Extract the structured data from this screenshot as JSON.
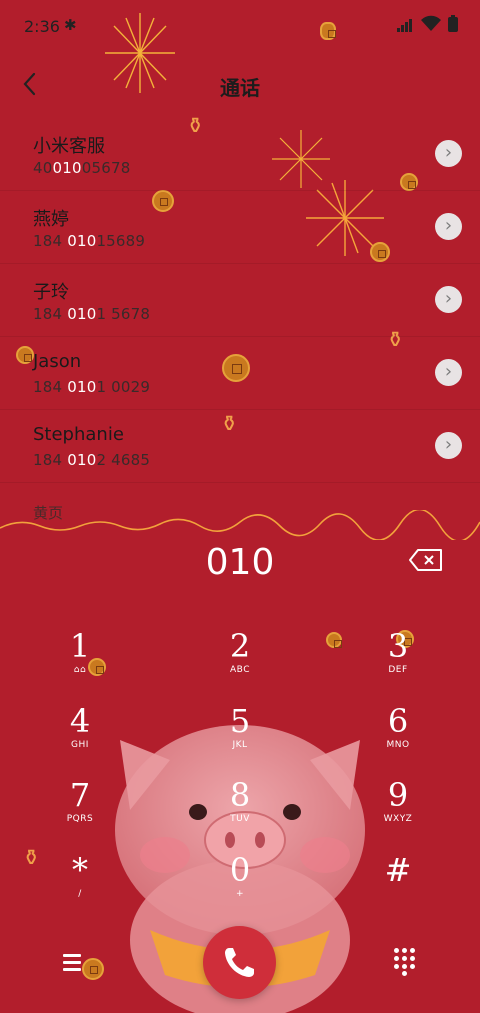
{
  "status_bar": {
    "time": "2:36",
    "bluetooth_icon": "bluetooth-icon",
    "signal_icon": "signal-icon",
    "wifi_icon": "wifi-icon",
    "battery_icon": "battery-icon"
  },
  "header": {
    "title": "通话",
    "back_icon": "chevron-left-icon"
  },
  "contacts": [
    {
      "name": "小米客服",
      "num_pre": "40",
      "num_hl": "010",
      "num_post": "05678"
    },
    {
      "name": "燕婷",
      "num_pre": "184 ",
      "num_hl": "010",
      "num_post": "15689"
    },
    {
      "name": "子玲",
      "num_pre": "184 ",
      "num_hl": "010",
      "num_post": "1 5678"
    },
    {
      "name": "Jason",
      "num_pre": "184 ",
      "num_hl": "010",
      "num_post": "1 0029"
    },
    {
      "name": "Stephanie",
      "num_pre": "184 ",
      "num_hl": "010",
      "num_post": "2 4685"
    }
  ],
  "section_label": "黄页",
  "dialer": {
    "number": "010",
    "keys": [
      {
        "digit": "1",
        "letters": "⌂⌂"
      },
      {
        "digit": "2",
        "letters": "ABC"
      },
      {
        "digit": "3",
        "letters": "DEF"
      },
      {
        "digit": "4",
        "letters": "GHI"
      },
      {
        "digit": "5",
        "letters": "JKL"
      },
      {
        "digit": "6",
        "letters": "MNO"
      },
      {
        "digit": "7",
        "letters": "PQRS"
      },
      {
        "digit": "8",
        "letters": "TUV"
      },
      {
        "digit": "9",
        "letters": "WXYZ"
      },
      {
        "digit": "*",
        "letters": "/"
      },
      {
        "digit": "0",
        "letters": "+"
      },
      {
        "digit": "#",
        "letters": ""
      }
    ]
  },
  "colors": {
    "background": "#b21e2c",
    "call_button": "#cf2e3a",
    "highlight": "#ffffff"
  }
}
